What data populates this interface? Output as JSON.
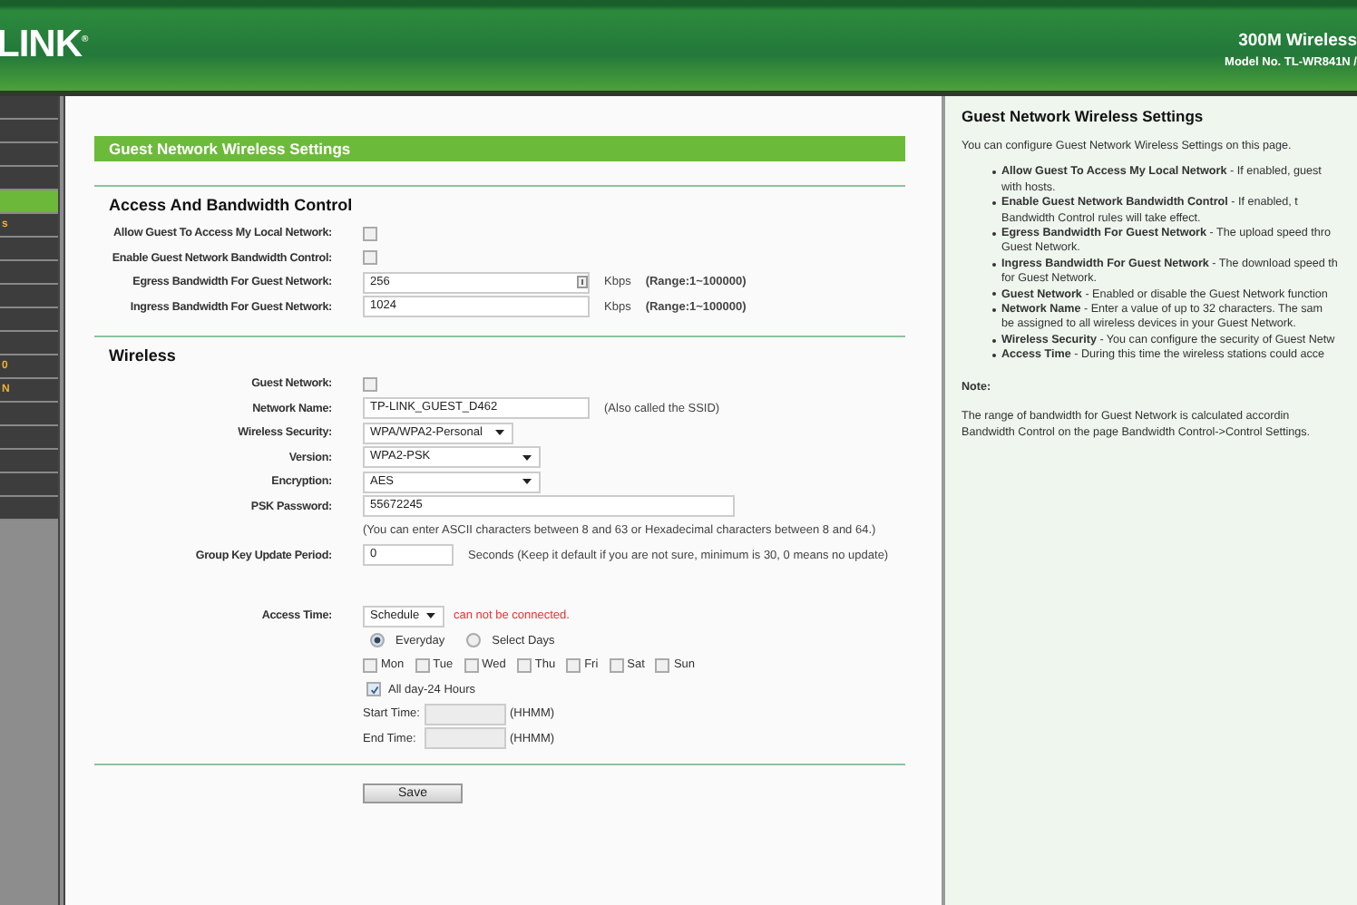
{
  "header": {
    "logo": "LINK",
    "logo_mark": "®",
    "product": "300M Wireless",
    "model": "Model No. TL-WR841N /"
  },
  "sidebar": {
    "items": [
      {
        "selected": false
      },
      {
        "selected": false
      },
      {
        "selected": false
      },
      {
        "selected": false
      },
      {
        "selected": true
      },
      {
        "label": "s",
        "selected": false
      },
      {
        "selected": false
      },
      {
        "selected": false
      },
      {
        "selected": false
      },
      {
        "selected": false
      },
      {
        "selected": false
      },
      {
        "label": "0",
        "selected": false
      },
      {
        "label": "N",
        "selected": false
      },
      {
        "selected": false
      },
      {
        "selected": false
      },
      {
        "selected": false
      },
      {
        "selected": false
      },
      {
        "selected": false
      }
    ]
  },
  "main": {
    "title": "Guest Network Wireless Settings",
    "sections": [
      {
        "heading": "Access And Bandwidth Control",
        "rows": [
          {
            "kind": "checkbox",
            "label": "Allow Guest To Access My Local Network:",
            "checked": false
          },
          {
            "kind": "checkbox",
            "label": "Enable Guest Network Bandwidth Control:",
            "checked": false
          },
          {
            "kind": "spin",
            "label": "Egress Bandwidth For Guest Network:",
            "value": "256",
            "unit": "Kbps",
            "note": "(Range:1~100000)"
          },
          {
            "kind": "text",
            "label": "Ingress Bandwidth For Guest Network:",
            "value": "1024",
            "unit": "Kbps",
            "note": "(Range:1~100000)"
          }
        ]
      },
      {
        "heading": "Wireless",
        "rows": [
          {
            "kind": "checkbox",
            "label": "Guest Network:",
            "checked": false
          },
          {
            "kind": "text",
            "label": "Network Name:",
            "value": "TP-LINK_GUEST_D462",
            "note": "(Also called the SSID)"
          },
          {
            "kind": "select",
            "label": "Wireless Security:",
            "value": "WPA/WPA2-Personal"
          },
          {
            "kind": "wide_select",
            "label": "Version:",
            "value": "WPA2-PSK"
          },
          {
            "kind": "wide_select",
            "label": "Encryption:",
            "value": "AES"
          },
          {
            "kind": "long_text",
            "label": "PSK Password:",
            "value": "55672245"
          },
          {
            "kind": "hint",
            "text": "(You can enter ASCII characters between 8 and 63 or Hexadecimal characters between 8 and 64.)"
          },
          {
            "kind": "short_text",
            "label": "Group Key Update Period:",
            "value": "0",
            "note": "Seconds (Keep it default if you are not sure, minimum is 30, 0 means no update)"
          }
        ]
      }
    ],
    "access_time": {
      "label": "Access Time:",
      "value": "Schedule",
      "warning": "can not be connected.",
      "modes": [
        {
          "label": "Everyday",
          "selected": true
        },
        {
          "label": "Select Days",
          "selected": false
        }
      ],
      "days": [
        {
          "label": "Mon",
          "checked": false
        },
        {
          "label": "Tue",
          "checked": false
        },
        {
          "label": "Wed",
          "checked": false
        },
        {
          "label": "Thu",
          "checked": false
        },
        {
          "label": "Fri",
          "checked": false
        },
        {
          "label": "Sat",
          "checked": false
        },
        {
          "label": "Sun",
          "checked": false
        }
      ],
      "all_day": {
        "label": "All day-24 Hours",
        "checked": true
      },
      "times": [
        {
          "label": "Start Time:",
          "hint": "(HHMM)",
          "disabled": true
        },
        {
          "label": "End Time:",
          "hint": "(HHMM)",
          "disabled": true
        }
      ]
    },
    "save": "Save"
  },
  "help": {
    "title": "Guest Network Wireless Settings",
    "intro": "You can configure Guest Network Wireless Settings on this page.",
    "bullets": [
      {
        "term": "Allow Guest To Access My Local Network",
        "lines": [
          " - If enabled, guest",
          "with hosts."
        ]
      },
      {
        "term": "Enable Guest Network Bandwidth Control",
        "lines": [
          " - If enabled, t",
          "Bandwidth Control rules will take effect."
        ]
      },
      {
        "term": "Egress Bandwidth For Guest Network",
        "lines": [
          " - The upload speed thro",
          "Guest Network."
        ]
      },
      {
        "term": "Ingress Bandwidth For Guest Network",
        "lines": [
          " - The download speed th",
          "for Guest Network."
        ]
      },
      {
        "term": "Guest Network",
        "lines": [
          " - Enabled or disable the Guest Network function"
        ]
      },
      {
        "term": "Network Name",
        "lines": [
          " - Enter a value of up to 32 characters. The sam",
          "be assigned to all wireless devices in your Guest Network."
        ]
      },
      {
        "term": "Wireless Security",
        "lines": [
          " - You can configure the security of Guest Netw"
        ]
      },
      {
        "term": "Access Time",
        "lines": [
          " - During this time the wireless stations could acce"
        ]
      }
    ],
    "note_label": "Note:",
    "note_lines": [
      "The range of bandwidth for Guest Network is calculated accordin",
      "Bandwidth Control on the page Bandwidth Control->Control Settings."
    ]
  }
}
